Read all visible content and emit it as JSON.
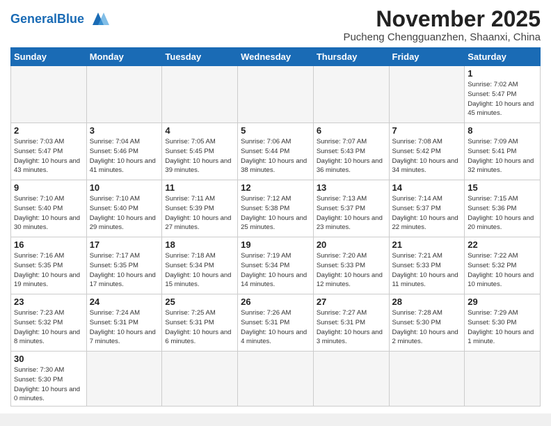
{
  "header": {
    "logo_general": "General",
    "logo_blue": "Blue",
    "month_title": "November 2025",
    "location": "Pucheng Chengguanzhen, Shaanxi, China"
  },
  "weekdays": [
    "Sunday",
    "Monday",
    "Tuesday",
    "Wednesday",
    "Thursday",
    "Friday",
    "Saturday"
  ],
  "days": [
    {
      "num": "",
      "info": "",
      "empty": true
    },
    {
      "num": "",
      "info": "",
      "empty": true
    },
    {
      "num": "",
      "info": "",
      "empty": true
    },
    {
      "num": "",
      "info": "",
      "empty": true
    },
    {
      "num": "",
      "info": "",
      "empty": true
    },
    {
      "num": "",
      "info": "",
      "empty": true
    },
    {
      "num": "1",
      "info": "Sunrise: 7:02 AM\nSunset: 5:47 PM\nDaylight: 10 hours\nand 45 minutes.",
      "empty": false
    },
    {
      "num": "2",
      "info": "Sunrise: 7:03 AM\nSunset: 5:47 PM\nDaylight: 10 hours\nand 43 minutes.",
      "empty": false
    },
    {
      "num": "3",
      "info": "Sunrise: 7:04 AM\nSunset: 5:46 PM\nDaylight: 10 hours\nand 41 minutes.",
      "empty": false
    },
    {
      "num": "4",
      "info": "Sunrise: 7:05 AM\nSunset: 5:45 PM\nDaylight: 10 hours\nand 39 minutes.",
      "empty": false
    },
    {
      "num": "5",
      "info": "Sunrise: 7:06 AM\nSunset: 5:44 PM\nDaylight: 10 hours\nand 38 minutes.",
      "empty": false
    },
    {
      "num": "6",
      "info": "Sunrise: 7:07 AM\nSunset: 5:43 PM\nDaylight: 10 hours\nand 36 minutes.",
      "empty": false
    },
    {
      "num": "7",
      "info": "Sunrise: 7:08 AM\nSunset: 5:42 PM\nDaylight: 10 hours\nand 34 minutes.",
      "empty": false
    },
    {
      "num": "8",
      "info": "Sunrise: 7:09 AM\nSunset: 5:41 PM\nDaylight: 10 hours\nand 32 minutes.",
      "empty": false
    },
    {
      "num": "9",
      "info": "Sunrise: 7:10 AM\nSunset: 5:40 PM\nDaylight: 10 hours\nand 30 minutes.",
      "empty": false
    },
    {
      "num": "10",
      "info": "Sunrise: 7:10 AM\nSunset: 5:40 PM\nDaylight: 10 hours\nand 29 minutes.",
      "empty": false
    },
    {
      "num": "11",
      "info": "Sunrise: 7:11 AM\nSunset: 5:39 PM\nDaylight: 10 hours\nand 27 minutes.",
      "empty": false
    },
    {
      "num": "12",
      "info": "Sunrise: 7:12 AM\nSunset: 5:38 PM\nDaylight: 10 hours\nand 25 minutes.",
      "empty": false
    },
    {
      "num": "13",
      "info": "Sunrise: 7:13 AM\nSunset: 5:37 PM\nDaylight: 10 hours\nand 23 minutes.",
      "empty": false
    },
    {
      "num": "14",
      "info": "Sunrise: 7:14 AM\nSunset: 5:37 PM\nDaylight: 10 hours\nand 22 minutes.",
      "empty": false
    },
    {
      "num": "15",
      "info": "Sunrise: 7:15 AM\nSunset: 5:36 PM\nDaylight: 10 hours\nand 20 minutes.",
      "empty": false
    },
    {
      "num": "16",
      "info": "Sunrise: 7:16 AM\nSunset: 5:35 PM\nDaylight: 10 hours\nand 19 minutes.",
      "empty": false
    },
    {
      "num": "17",
      "info": "Sunrise: 7:17 AM\nSunset: 5:35 PM\nDaylight: 10 hours\nand 17 minutes.",
      "empty": false
    },
    {
      "num": "18",
      "info": "Sunrise: 7:18 AM\nSunset: 5:34 PM\nDaylight: 10 hours\nand 15 minutes.",
      "empty": false
    },
    {
      "num": "19",
      "info": "Sunrise: 7:19 AM\nSunset: 5:34 PM\nDaylight: 10 hours\nand 14 minutes.",
      "empty": false
    },
    {
      "num": "20",
      "info": "Sunrise: 7:20 AM\nSunset: 5:33 PM\nDaylight: 10 hours\nand 12 minutes.",
      "empty": false
    },
    {
      "num": "21",
      "info": "Sunrise: 7:21 AM\nSunset: 5:33 PM\nDaylight: 10 hours\nand 11 minutes.",
      "empty": false
    },
    {
      "num": "22",
      "info": "Sunrise: 7:22 AM\nSunset: 5:32 PM\nDaylight: 10 hours\nand 10 minutes.",
      "empty": false
    },
    {
      "num": "23",
      "info": "Sunrise: 7:23 AM\nSunset: 5:32 PM\nDaylight: 10 hours\nand 8 minutes.",
      "empty": false
    },
    {
      "num": "24",
      "info": "Sunrise: 7:24 AM\nSunset: 5:31 PM\nDaylight: 10 hours\nand 7 minutes.",
      "empty": false
    },
    {
      "num": "25",
      "info": "Sunrise: 7:25 AM\nSunset: 5:31 PM\nDaylight: 10 hours\nand 6 minutes.",
      "empty": false
    },
    {
      "num": "26",
      "info": "Sunrise: 7:26 AM\nSunset: 5:31 PM\nDaylight: 10 hours\nand 4 minutes.",
      "empty": false
    },
    {
      "num": "27",
      "info": "Sunrise: 7:27 AM\nSunset: 5:31 PM\nDaylight: 10 hours\nand 3 minutes.",
      "empty": false
    },
    {
      "num": "28",
      "info": "Sunrise: 7:28 AM\nSunset: 5:30 PM\nDaylight: 10 hours\nand 2 minutes.",
      "empty": false
    },
    {
      "num": "29",
      "info": "Sunrise: 7:29 AM\nSunset: 5:30 PM\nDaylight: 10 hours\nand 1 minute.",
      "empty": false
    },
    {
      "num": "30",
      "info": "Sunrise: 7:30 AM\nSunset: 5:30 PM\nDaylight: 10 hours\nand 0 minutes.",
      "empty": false
    },
    {
      "num": "",
      "info": "",
      "empty": true
    },
    {
      "num": "",
      "info": "",
      "empty": true
    },
    {
      "num": "",
      "info": "",
      "empty": true
    },
    {
      "num": "",
      "info": "",
      "empty": true
    },
    {
      "num": "",
      "info": "",
      "empty": true
    },
    {
      "num": "",
      "info": "",
      "empty": true
    }
  ]
}
